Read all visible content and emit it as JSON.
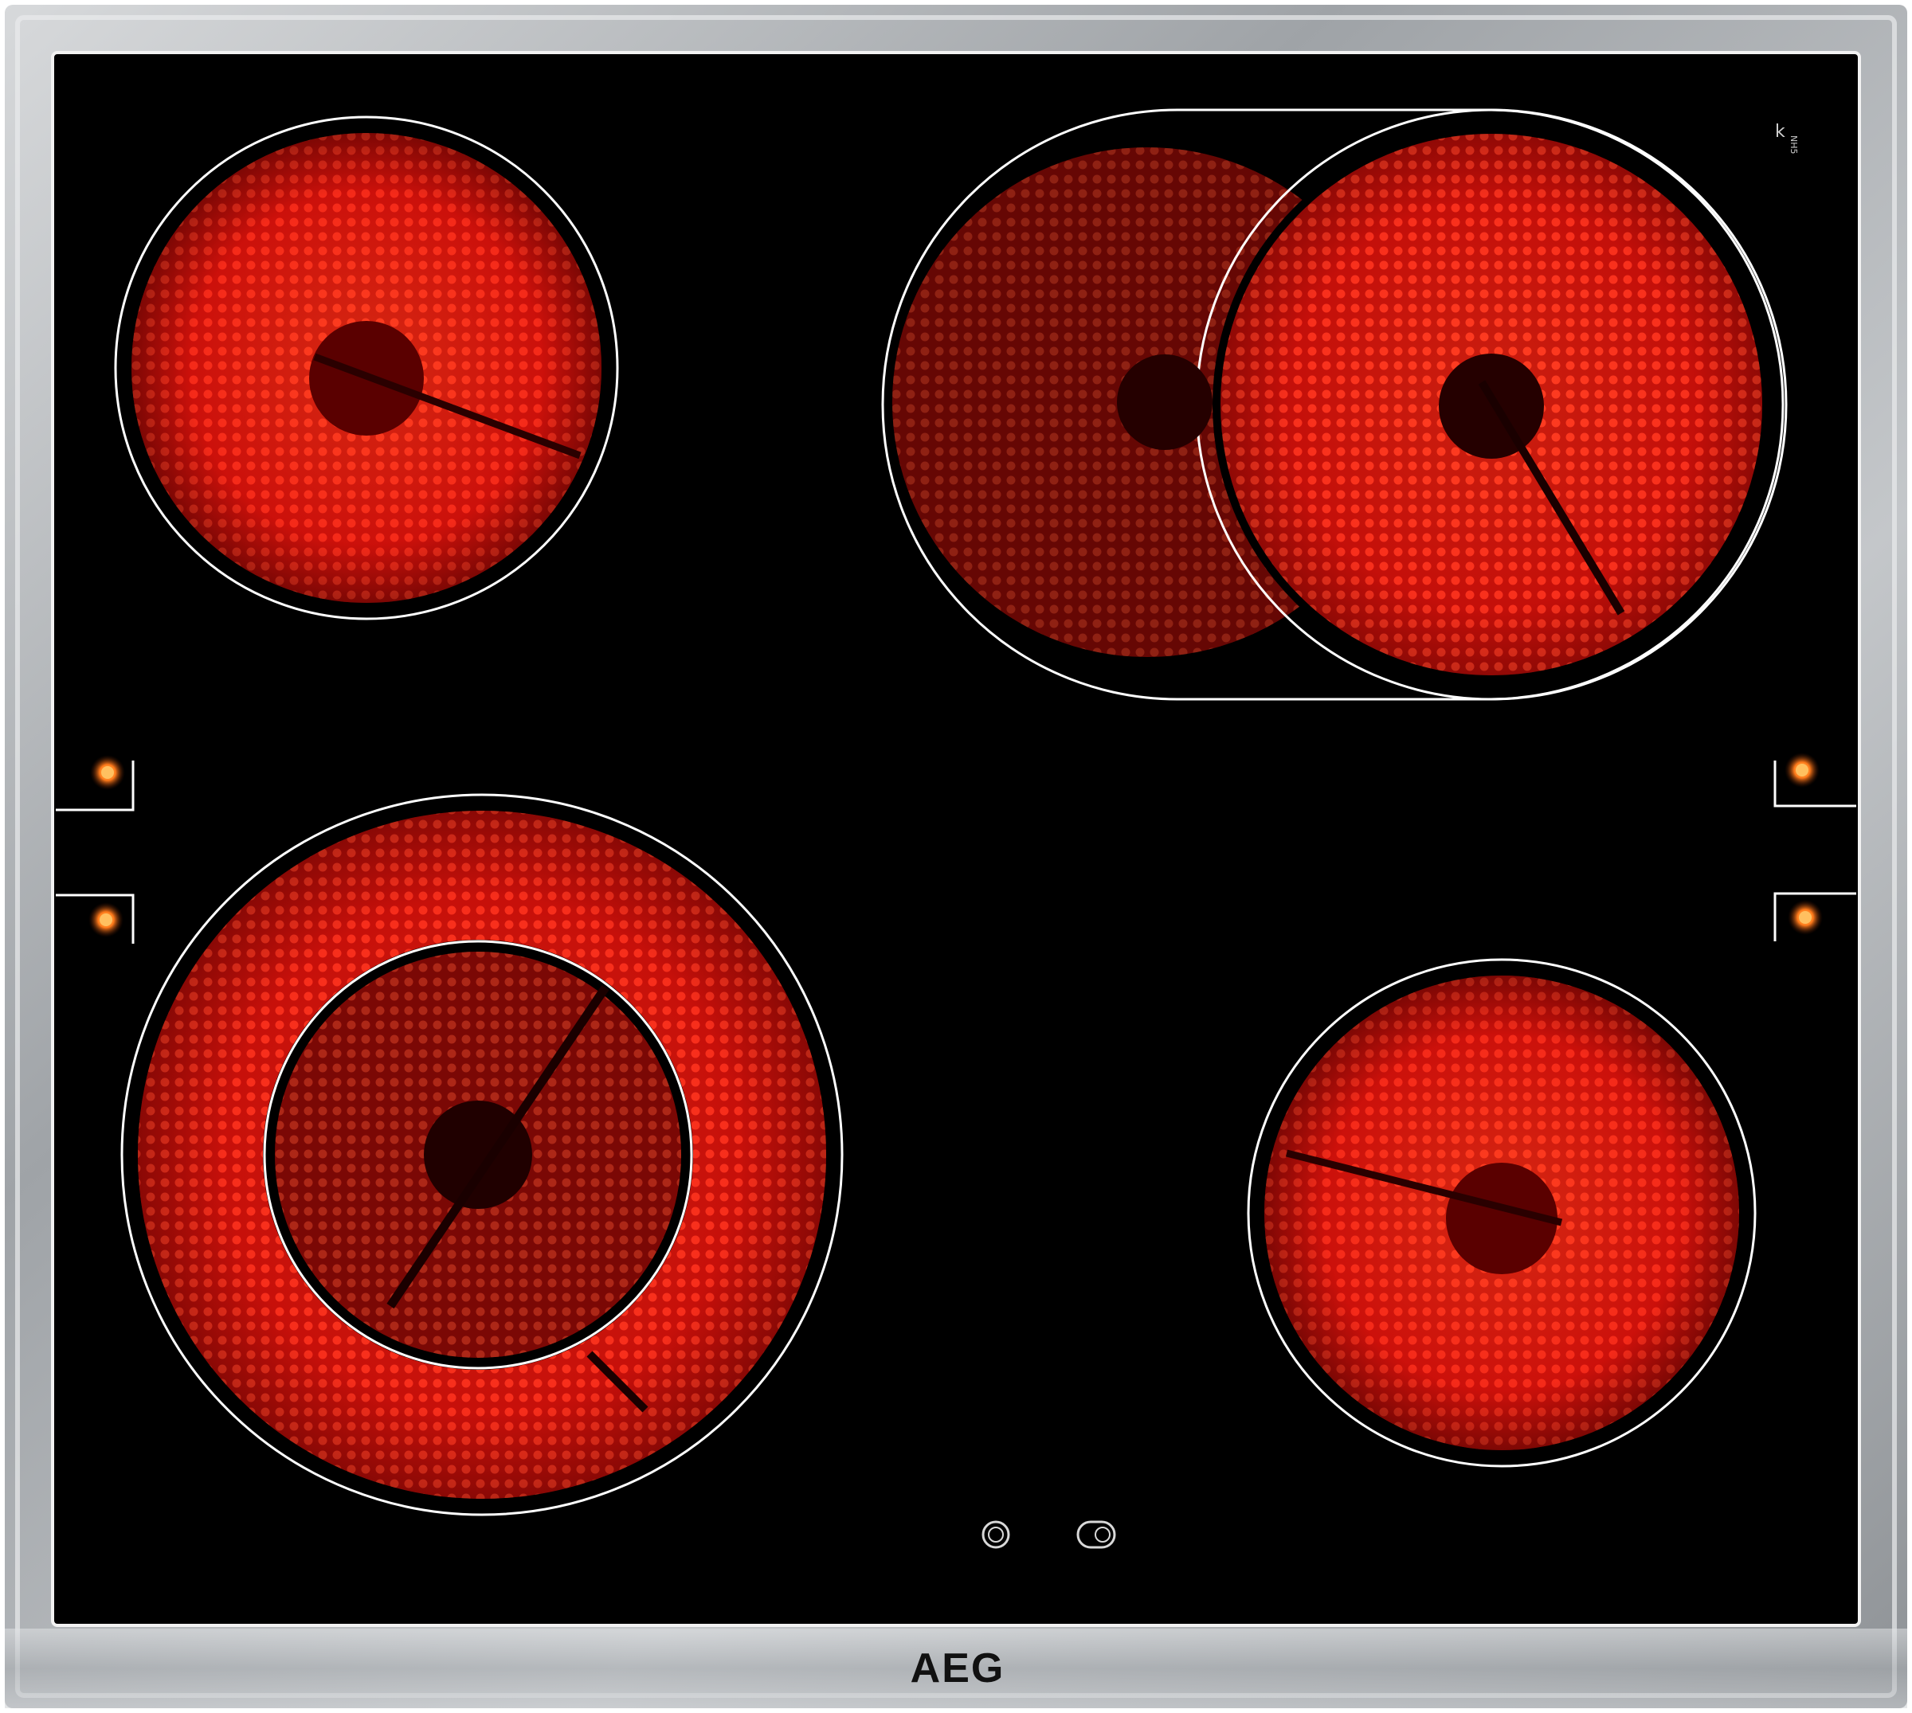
{
  "hob": {
    "brand": "AEG",
    "corner_mark": "k",
    "corner_code": "NH5",
    "colors": {
      "frame": "#b9bcbf",
      "glass": "#000000",
      "zone_hot": "#ff2417",
      "zone_dark": "#5a0000",
      "indicator": "#ff7a1a",
      "outline": "#ffffff"
    },
    "zones": [
      {
        "id": "rear-left",
        "type": "single"
      },
      {
        "id": "rear-right",
        "type": "extended-oval"
      },
      {
        "id": "front-left",
        "type": "dual-ring"
      },
      {
        "id": "front-right",
        "type": "single"
      }
    ],
    "indicator_lights": 4,
    "symbols": [
      "single-ring-zone-symbol-icon",
      "oval-zone-symbol-icon"
    ]
  }
}
